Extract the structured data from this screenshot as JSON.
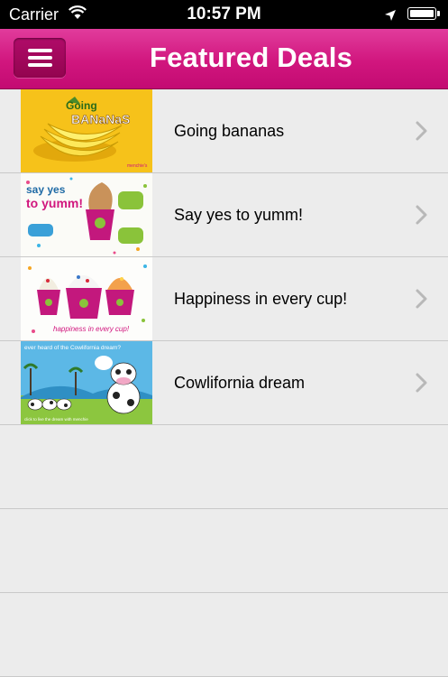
{
  "status_bar": {
    "carrier": "Carrier",
    "time": "10:57 PM"
  },
  "nav": {
    "title": "Featured Deals",
    "menu_icon": "hamburger-icon"
  },
  "deals": [
    {
      "title": "Going bananas",
      "image_text": "Going Bananas"
    },
    {
      "title": "Say yes to yumm!",
      "image_text": "say yes to yumm!"
    },
    {
      "title": "Happiness in every cup!",
      "image_text": "happiness in every cup!"
    },
    {
      "title": "Cowlifornia dream",
      "image_text": "ever heard of the Cowlifornia dream?"
    }
  ],
  "colors": {
    "nav_accent": "#d1167e",
    "background": "#ececec",
    "chevron": "#b8b8b8"
  }
}
